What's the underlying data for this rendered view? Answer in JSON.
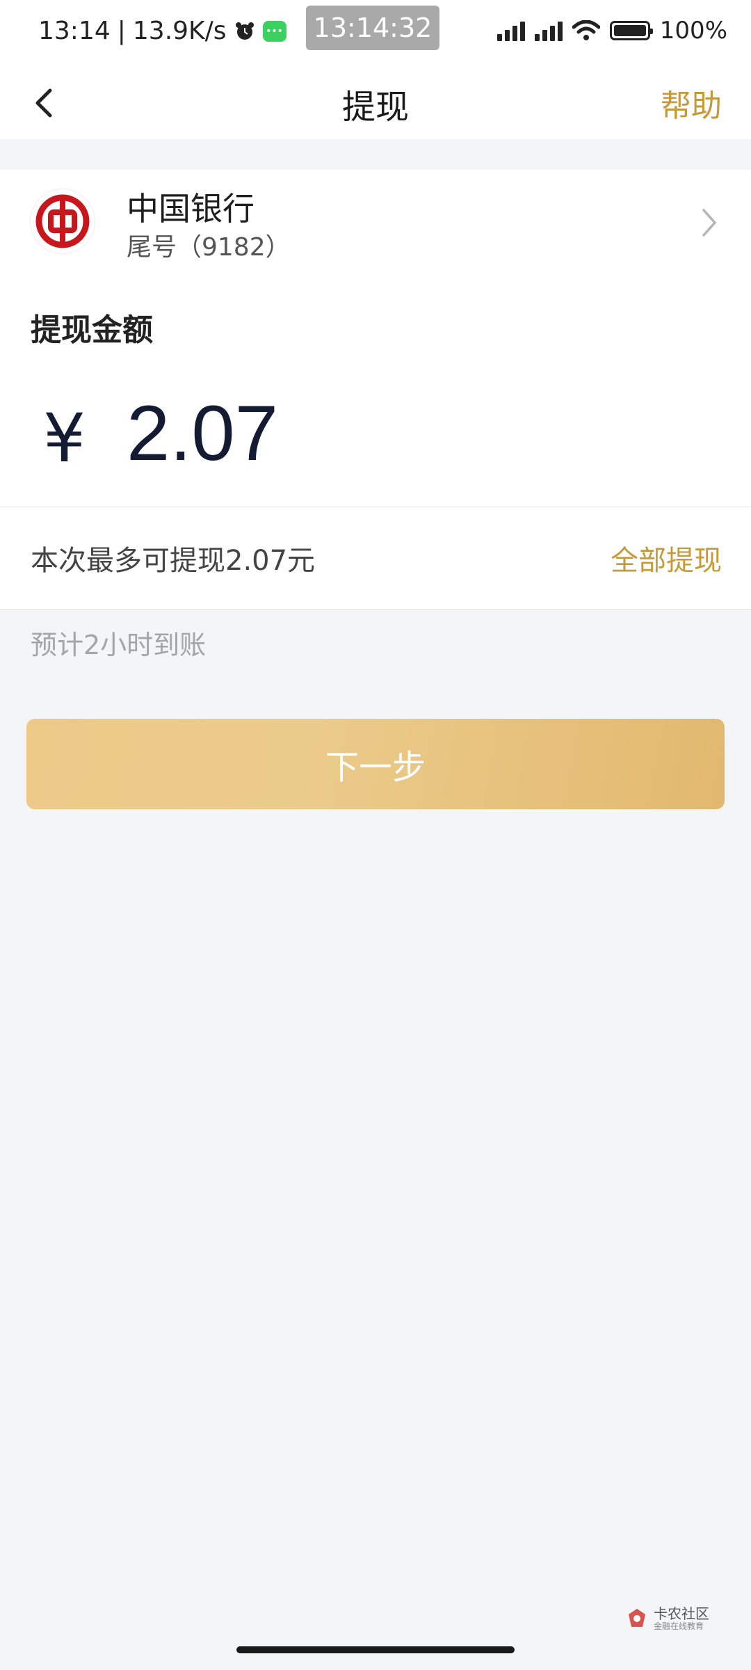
{
  "status_bar": {
    "time": "13:14",
    "network_speed": "13.9K/s",
    "center_clock": "13:14:32",
    "battery": "100%",
    "icons": [
      "alarm-icon",
      "message-icon",
      "signal-icon",
      "signal-icon",
      "wifi-icon",
      "battery-icon"
    ]
  },
  "header": {
    "title": "提现",
    "help_label": "帮助",
    "back_icon": "chevron-left-icon"
  },
  "bank": {
    "name": "中国银行",
    "tail_number": "尾号（9182）",
    "logo_icon": "bank-of-china-logo",
    "chevron_icon": "chevron-right-icon"
  },
  "amount": {
    "label": "提现金额",
    "currency_symbol": "¥",
    "value": "2.07"
  },
  "limit": {
    "text": "本次最多可提现2.07元",
    "withdraw_all_label": "全部提现"
  },
  "arrival_note": "预计2小时到账",
  "next_button_label": "下一步",
  "watermark": {
    "main": "卡农社区",
    "sub": "金融在线教育"
  },
  "colors": {
    "accent_gold": "#c59a3a",
    "button_gold": "#e8c27d",
    "amount_text": "#141c33",
    "background": "#f4f5f7"
  }
}
